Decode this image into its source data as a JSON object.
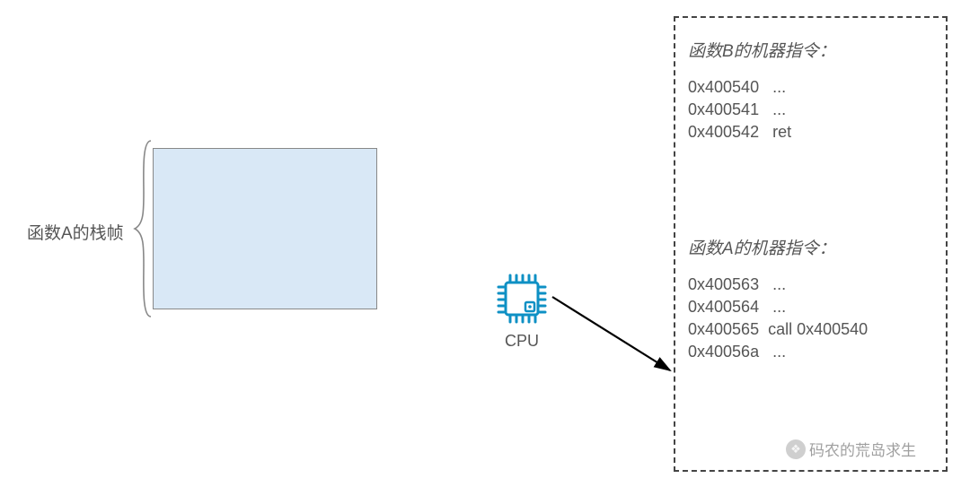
{
  "frame": {
    "label": "函数A的栈帧"
  },
  "cpu": {
    "label": "CPU"
  },
  "code": {
    "funcB": {
      "title": "函数B的机器指令：",
      "lines": [
        {
          "addr": "0x400540",
          "instr": "..."
        },
        {
          "addr": "0x400541",
          "instr": "..."
        },
        {
          "addr": "0x400542",
          "instr": "ret"
        }
      ]
    },
    "funcA": {
      "title": "函数A的机器指令：",
      "lines": [
        {
          "addr": "0x400563",
          "instr": "..."
        },
        {
          "addr": "0x400564",
          "instr": "..."
        },
        {
          "addr": "0x400565",
          "instr": "call 0x400540"
        },
        {
          "addr": "0x40056a",
          "instr": "..."
        }
      ]
    }
  },
  "watermark": {
    "text": "码农的荒岛求生"
  },
  "colors": {
    "frame_fill": "#d9e8f6",
    "frame_stroke": "#888",
    "cpu": "#0e90c4"
  }
}
